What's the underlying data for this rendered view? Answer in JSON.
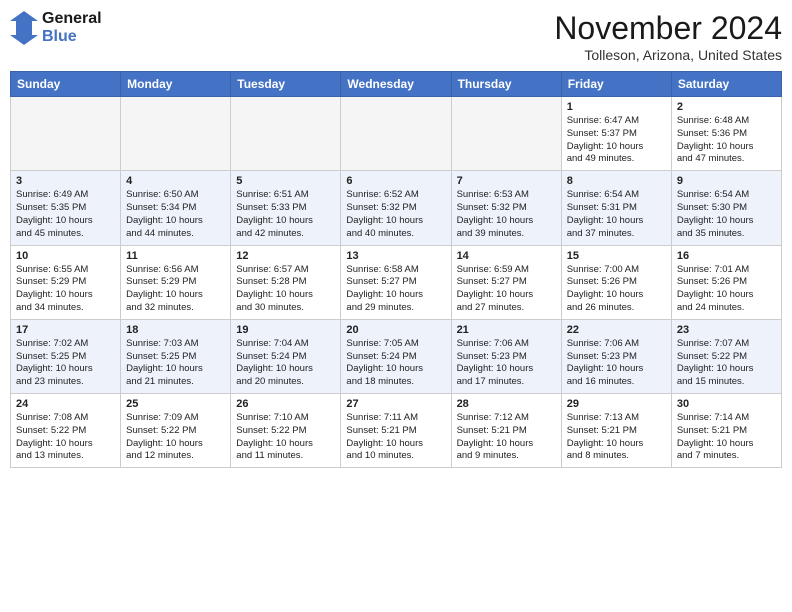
{
  "header": {
    "logo_line1": "General",
    "logo_line2": "Blue",
    "month_year": "November 2024",
    "location": "Tolleson, Arizona, United States"
  },
  "weekdays": [
    "Sunday",
    "Monday",
    "Tuesday",
    "Wednesday",
    "Thursday",
    "Friday",
    "Saturday"
  ],
  "weeks": [
    [
      {
        "day": "",
        "info": ""
      },
      {
        "day": "",
        "info": ""
      },
      {
        "day": "",
        "info": ""
      },
      {
        "day": "",
        "info": ""
      },
      {
        "day": "",
        "info": ""
      },
      {
        "day": "1",
        "info": "Sunrise: 6:47 AM\nSunset: 5:37 PM\nDaylight: 10 hours\nand 49 minutes."
      },
      {
        "day": "2",
        "info": "Sunrise: 6:48 AM\nSunset: 5:36 PM\nDaylight: 10 hours\nand 47 minutes."
      }
    ],
    [
      {
        "day": "3",
        "info": "Sunrise: 6:49 AM\nSunset: 5:35 PM\nDaylight: 10 hours\nand 45 minutes."
      },
      {
        "day": "4",
        "info": "Sunrise: 6:50 AM\nSunset: 5:34 PM\nDaylight: 10 hours\nand 44 minutes."
      },
      {
        "day": "5",
        "info": "Sunrise: 6:51 AM\nSunset: 5:33 PM\nDaylight: 10 hours\nand 42 minutes."
      },
      {
        "day": "6",
        "info": "Sunrise: 6:52 AM\nSunset: 5:32 PM\nDaylight: 10 hours\nand 40 minutes."
      },
      {
        "day": "7",
        "info": "Sunrise: 6:53 AM\nSunset: 5:32 PM\nDaylight: 10 hours\nand 39 minutes."
      },
      {
        "day": "8",
        "info": "Sunrise: 6:54 AM\nSunset: 5:31 PM\nDaylight: 10 hours\nand 37 minutes."
      },
      {
        "day": "9",
        "info": "Sunrise: 6:54 AM\nSunset: 5:30 PM\nDaylight: 10 hours\nand 35 minutes."
      }
    ],
    [
      {
        "day": "10",
        "info": "Sunrise: 6:55 AM\nSunset: 5:29 PM\nDaylight: 10 hours\nand 34 minutes."
      },
      {
        "day": "11",
        "info": "Sunrise: 6:56 AM\nSunset: 5:29 PM\nDaylight: 10 hours\nand 32 minutes."
      },
      {
        "day": "12",
        "info": "Sunrise: 6:57 AM\nSunset: 5:28 PM\nDaylight: 10 hours\nand 30 minutes."
      },
      {
        "day": "13",
        "info": "Sunrise: 6:58 AM\nSunset: 5:27 PM\nDaylight: 10 hours\nand 29 minutes."
      },
      {
        "day": "14",
        "info": "Sunrise: 6:59 AM\nSunset: 5:27 PM\nDaylight: 10 hours\nand 27 minutes."
      },
      {
        "day": "15",
        "info": "Sunrise: 7:00 AM\nSunset: 5:26 PM\nDaylight: 10 hours\nand 26 minutes."
      },
      {
        "day": "16",
        "info": "Sunrise: 7:01 AM\nSunset: 5:26 PM\nDaylight: 10 hours\nand 24 minutes."
      }
    ],
    [
      {
        "day": "17",
        "info": "Sunrise: 7:02 AM\nSunset: 5:25 PM\nDaylight: 10 hours\nand 23 minutes."
      },
      {
        "day": "18",
        "info": "Sunrise: 7:03 AM\nSunset: 5:25 PM\nDaylight: 10 hours\nand 21 minutes."
      },
      {
        "day": "19",
        "info": "Sunrise: 7:04 AM\nSunset: 5:24 PM\nDaylight: 10 hours\nand 20 minutes."
      },
      {
        "day": "20",
        "info": "Sunrise: 7:05 AM\nSunset: 5:24 PM\nDaylight: 10 hours\nand 18 minutes."
      },
      {
        "day": "21",
        "info": "Sunrise: 7:06 AM\nSunset: 5:23 PM\nDaylight: 10 hours\nand 17 minutes."
      },
      {
        "day": "22",
        "info": "Sunrise: 7:06 AM\nSunset: 5:23 PM\nDaylight: 10 hours\nand 16 minutes."
      },
      {
        "day": "23",
        "info": "Sunrise: 7:07 AM\nSunset: 5:22 PM\nDaylight: 10 hours\nand 15 minutes."
      }
    ],
    [
      {
        "day": "24",
        "info": "Sunrise: 7:08 AM\nSunset: 5:22 PM\nDaylight: 10 hours\nand 13 minutes."
      },
      {
        "day": "25",
        "info": "Sunrise: 7:09 AM\nSunset: 5:22 PM\nDaylight: 10 hours\nand 12 minutes."
      },
      {
        "day": "26",
        "info": "Sunrise: 7:10 AM\nSunset: 5:22 PM\nDaylight: 10 hours\nand 11 minutes."
      },
      {
        "day": "27",
        "info": "Sunrise: 7:11 AM\nSunset: 5:21 PM\nDaylight: 10 hours\nand 10 minutes."
      },
      {
        "day": "28",
        "info": "Sunrise: 7:12 AM\nSunset: 5:21 PM\nDaylight: 10 hours\nand 9 minutes."
      },
      {
        "day": "29",
        "info": "Sunrise: 7:13 AM\nSunset: 5:21 PM\nDaylight: 10 hours\nand 8 minutes."
      },
      {
        "day": "30",
        "info": "Sunrise: 7:14 AM\nSunset: 5:21 PM\nDaylight: 10 hours\nand 7 minutes."
      }
    ]
  ]
}
